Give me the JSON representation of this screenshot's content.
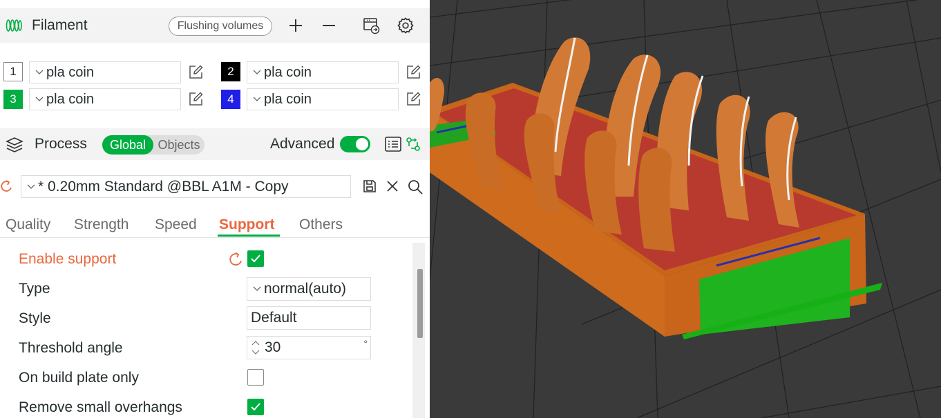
{
  "colors": {
    "accent": "#00ae42",
    "orange": "#e8683e",
    "slot3": "#00ae42",
    "slot2": "#000000",
    "slot4": "#1f1fe8"
  },
  "filament": {
    "title": "Filament",
    "flushing_label": "Flushing volumes",
    "slots": [
      {
        "number": "1",
        "name": "pla coin"
      },
      {
        "number": "2",
        "name": "pla coin"
      },
      {
        "number": "3",
        "name": "pla coin"
      },
      {
        "number": "4",
        "name": "pla coin"
      }
    ]
  },
  "process": {
    "title": "Process",
    "toggle_global": "Global",
    "toggle_objects": "Objects",
    "advanced_label": "Advanced",
    "preset_name": "* 0.20mm Standard @BBL A1M - Copy"
  },
  "tabs": [
    "Quality",
    "Strength",
    "Speed",
    "Support",
    "Others"
  ],
  "active_tab": "Support",
  "settings": {
    "enable_support": {
      "label": "Enable support",
      "checked": true
    },
    "type": {
      "label": "Type",
      "value": "normal(auto)"
    },
    "style": {
      "label": "Style",
      "value": "Default"
    },
    "threshold": {
      "label": "Threshold angle",
      "value": "30",
      "unit": "°"
    },
    "build_plate_only": {
      "label": "On build plate only",
      "checked": false
    },
    "remove_small": {
      "label": "Remove small overhangs",
      "checked": true
    }
  },
  "icons": [
    "filament-spool-icon",
    "plus-icon",
    "minus-icon",
    "sync-printer-icon",
    "gear-icon",
    "process-layers-icon",
    "list-icon",
    "compare-icon",
    "reset-icon",
    "save-icon",
    "close-icon",
    "search-icon",
    "chevron-down-icon",
    "check-icon"
  ]
}
